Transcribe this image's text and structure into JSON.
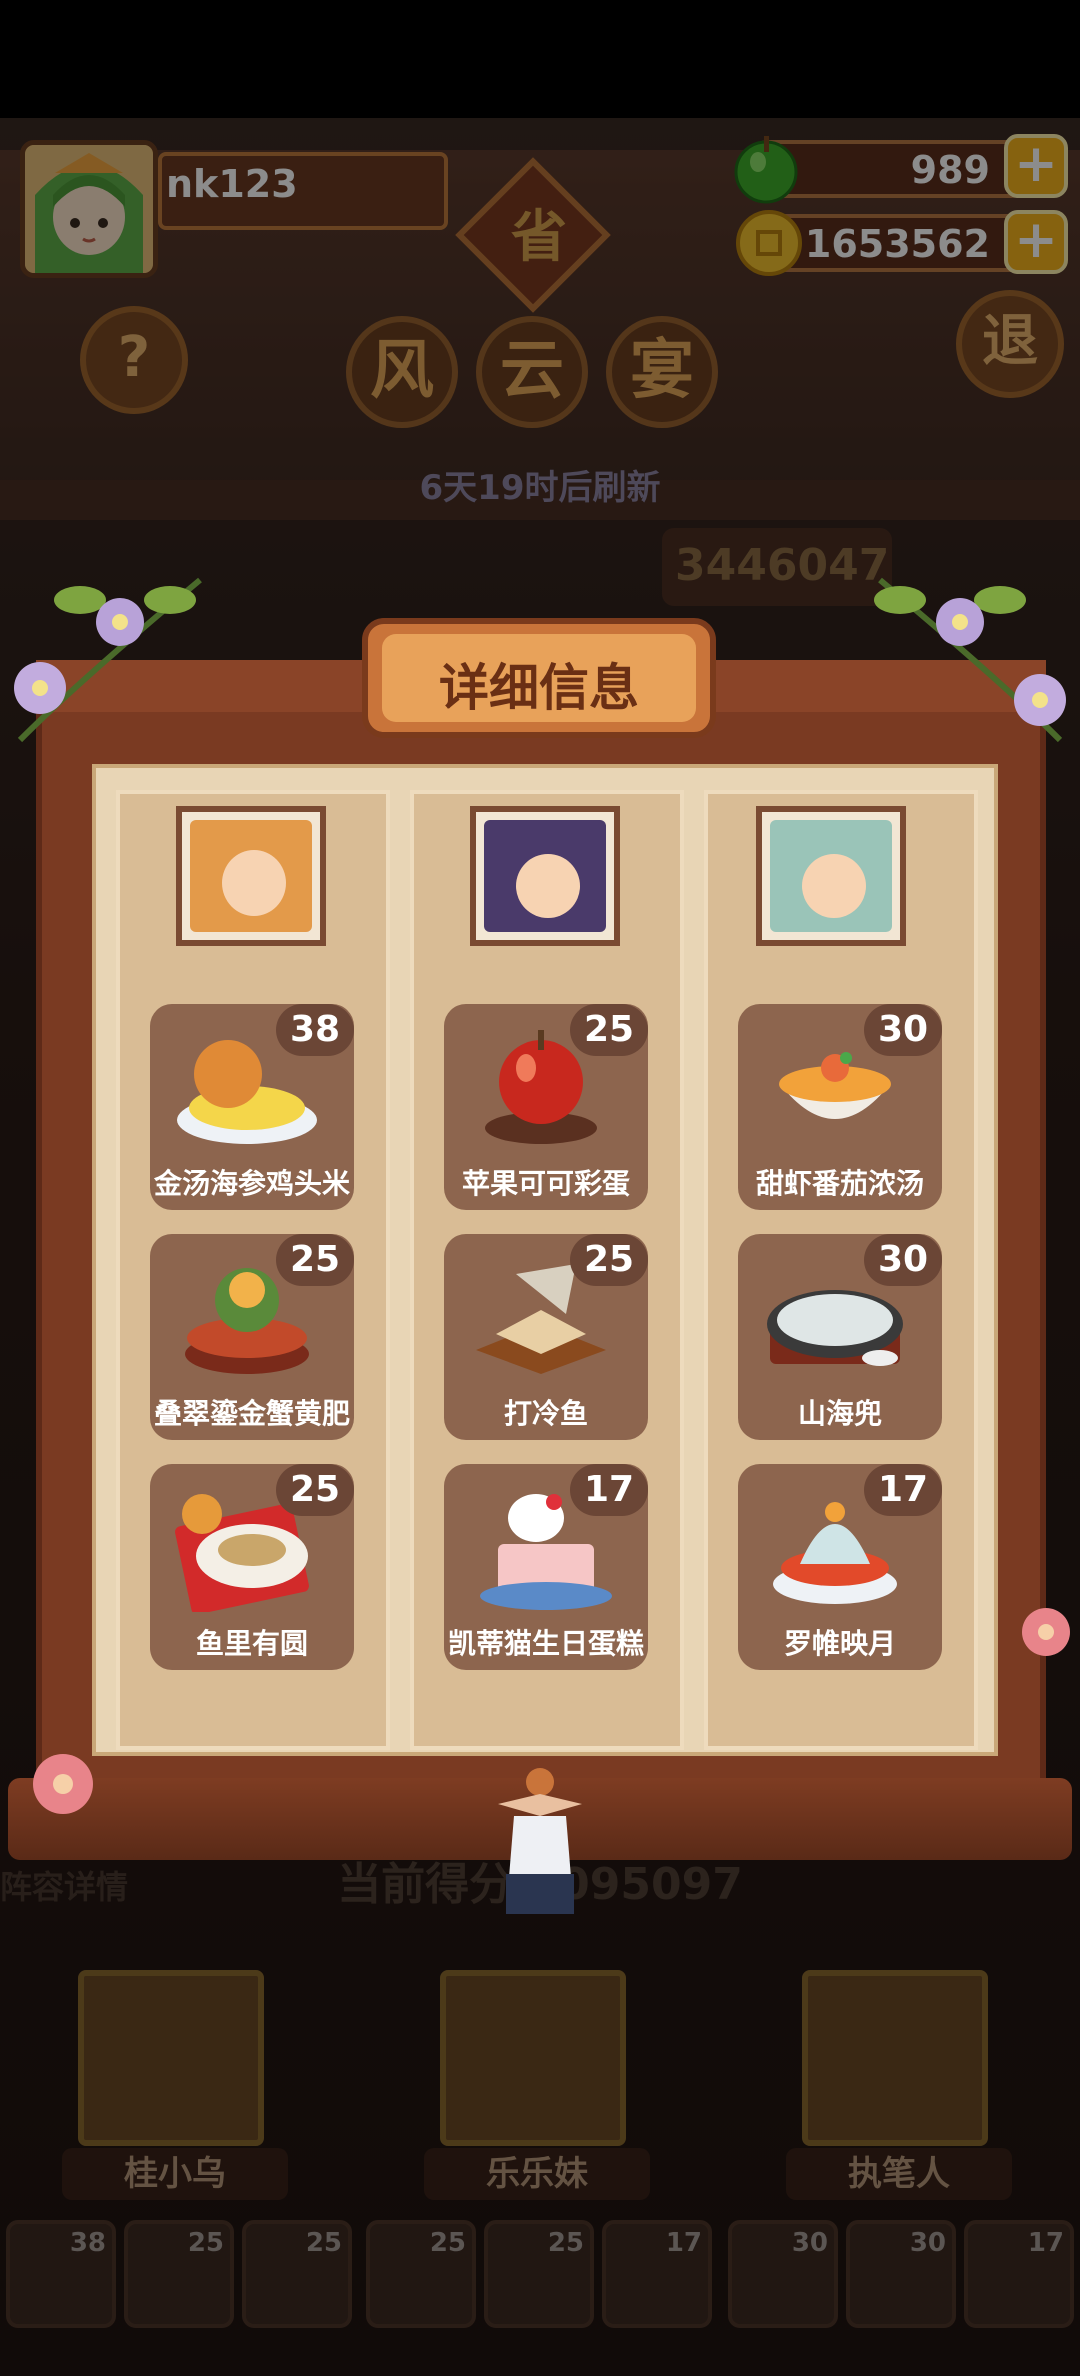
{
  "player": {
    "name": "nk123"
  },
  "resources": {
    "apples": "989",
    "coins": "1653562"
  },
  "hud": {
    "help_icon_char": "?",
    "exit_char": "退",
    "province_char": "省",
    "title_chars": [
      "风",
      "云",
      "宴"
    ],
    "refresh_text": "6天19时后刷新",
    "score_background": "3446047"
  },
  "panel": {
    "title": "详细信息",
    "columns": [
      {
        "chef": "桂小乌",
        "dishes": [
          {
            "name": "金汤海参鸡头米",
            "score": "38"
          },
          {
            "name": "叠翠鎏金蟹黄肥",
            "score": "25"
          },
          {
            "name": "鱼里有圆",
            "score": "25"
          }
        ]
      },
      {
        "chef": "乐乐妹",
        "dishes": [
          {
            "name": "苹果可可彩蛋",
            "score": "25"
          },
          {
            "name": "打冷鱼",
            "score": "25"
          },
          {
            "name": "凯蒂猫生日蛋糕",
            "score": "17"
          }
        ]
      },
      {
        "chef": "执笔人",
        "dishes": [
          {
            "name": "甜虾番茄浓汤",
            "score": "30"
          },
          {
            "name": "山海兜",
            "score": "30"
          },
          {
            "name": "罗帷映月",
            "score": "17"
          }
        ]
      }
    ]
  },
  "lower": {
    "lineup_label": "阵容详情",
    "current_score": "当前得分 3095097",
    "chefs": [
      "桂小乌",
      "乐乐妹",
      "执笔人"
    ],
    "slots": [
      "38",
      "25",
      "25",
      "25",
      "25",
      "17",
      "30",
      "30",
      "17"
    ]
  },
  "colors": {
    "frame": "#7a3a22",
    "paper": "#e8d5b5",
    "card": "#8d654e",
    "badge": "#6b4636",
    "plus": "#f5b21c",
    "apple": "#3fae2a",
    "coin": "#f2c12e"
  }
}
